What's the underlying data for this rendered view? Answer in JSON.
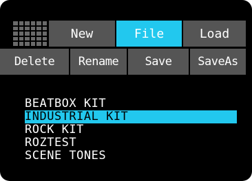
{
  "toolbar": {
    "grid_icon": "grid-icon",
    "new_label": "New",
    "file_label": "File",
    "load_label": "Load"
  },
  "actions": {
    "delete_label": "Delete",
    "rename_label": "Rename",
    "save_label": "Save",
    "saveas_label": "SaveAs"
  },
  "files": {
    "items": [
      {
        "label": "BEATBOX KIT",
        "selected": false
      },
      {
        "label": "INDUSTRIAL KIT",
        "selected": true
      },
      {
        "label": "ROCK KIT",
        "selected": false
      },
      {
        "label": "ROZTEST",
        "selected": false
      },
      {
        "label": "SCENE TONES",
        "selected": false
      }
    ]
  },
  "colors": {
    "background": "#000000",
    "button": "#555555",
    "accent": "#22c8ee",
    "text": "#ffffff"
  }
}
